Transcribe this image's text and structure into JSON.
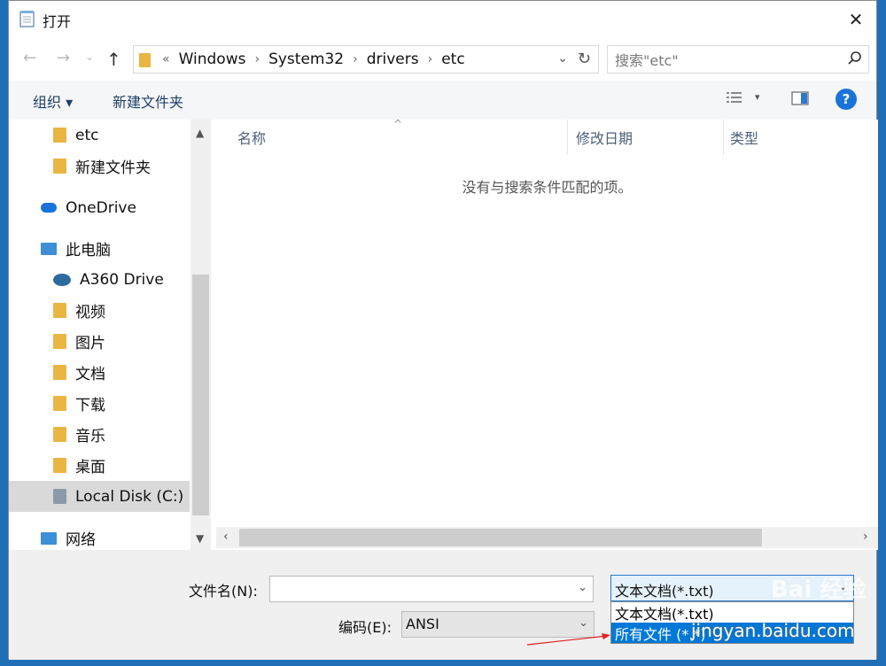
{
  "window": {
    "title": "打开"
  },
  "address": {
    "crumbs": [
      "Windows",
      "System32",
      "drivers",
      "etc"
    ],
    "overflow": "«"
  },
  "search": {
    "placeholder": "搜索\"etc\""
  },
  "toolbar": {
    "organize": "组织 ▾",
    "new_folder": "新建文件夹"
  },
  "sidebar": {
    "items": [
      {
        "label": "etc",
        "icon": "folder-icon",
        "color": "#e9b543"
      },
      {
        "label": "新建文件夹",
        "icon": "folder-icon",
        "color": "#e9b543"
      },
      {
        "label": "OneDrive",
        "icon": "cloud-icon",
        "color": "#1a73d9"
      },
      {
        "label": "此电脑",
        "icon": "computer-icon",
        "color": "#3d8fd6"
      },
      {
        "label": "A360 Drive",
        "icon": "a360-drive-icon",
        "color": "#2d6a9e"
      },
      {
        "label": "视频",
        "icon": "videos-folder-icon",
        "color": "#e9b543"
      },
      {
        "label": "图片",
        "icon": "pictures-folder-icon",
        "color": "#e9b543"
      },
      {
        "label": "文档",
        "icon": "documents-folder-icon",
        "color": "#e9b543"
      },
      {
        "label": "下载",
        "icon": "downloads-folder-icon",
        "color": "#e9b543"
      },
      {
        "label": "音乐",
        "icon": "music-folder-icon",
        "color": "#e9b543"
      },
      {
        "label": "桌面",
        "icon": "desktop-folder-icon",
        "color": "#e9b543"
      },
      {
        "label": "Local Disk (C:)",
        "icon": "local-disk-icon",
        "color": "#8a9aa8"
      },
      {
        "label": "网络",
        "icon": "network-icon",
        "color": "#3d8fd6"
      }
    ]
  },
  "content": {
    "columns": [
      "名称",
      "修改日期",
      "类型"
    ],
    "empty_message": "没有与搜索条件匹配的项。"
  },
  "bottom": {
    "filename_label": "文件名(N):",
    "filename_value": "",
    "encoding_label": "编码(E):",
    "encoding_value": "ANSI",
    "filetype_value": "文本文档(*.txt)",
    "filetype_options": [
      "文本文档(*.txt)",
      "所有文件  (*.*)"
    ]
  },
  "watermark": {
    "text": "jingyan.baidu.com",
    "logo": "Bai 经验"
  },
  "colors": {
    "accent": "#0078d7",
    "help": "#1a73d9",
    "arrow": "#e02020"
  }
}
